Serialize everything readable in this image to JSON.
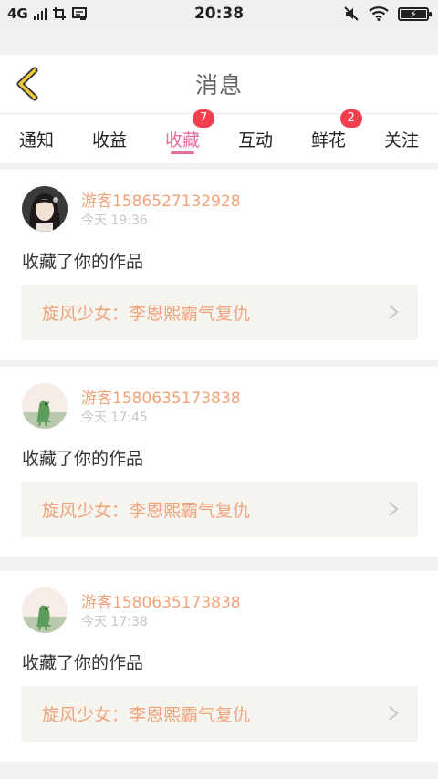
{
  "status_bar": {
    "network": "4G",
    "time": "20:38"
  },
  "header": {
    "title": "消息"
  },
  "tabs": [
    {
      "label": "通知",
      "badge": ""
    },
    {
      "label": "收益",
      "badge": ""
    },
    {
      "label": "收藏",
      "badge": "7",
      "active": true
    },
    {
      "label": "互动",
      "badge": ""
    },
    {
      "label": "鲜花",
      "badge": "2"
    },
    {
      "label": "关注",
      "badge": ""
    }
  ],
  "notifications": [
    {
      "user": "游客1586527132928",
      "time": "今天 19:36",
      "action": "收藏了你的作品",
      "work_title": "旋风少女：李恩熙霸气复仇",
      "avatar": "girl-photo"
    },
    {
      "user": "游客1580635173838",
      "time": "今天 17:45",
      "action": "收藏了你的作品",
      "work_title": "旋风少女：李恩熙霸气复仇",
      "avatar": "green-dinosaur"
    },
    {
      "user": "游客1580635173838",
      "time": "今天 17:38",
      "action": "收藏了你的作品",
      "work_title": "旋风少女：李恩熙霸气复仇",
      "avatar": "green-dinosaur"
    }
  ],
  "colors": {
    "accent": "#e86d9e",
    "username": "#f0a37a",
    "badge": "#f23f4f",
    "back_arrow": "#e9c93a"
  }
}
